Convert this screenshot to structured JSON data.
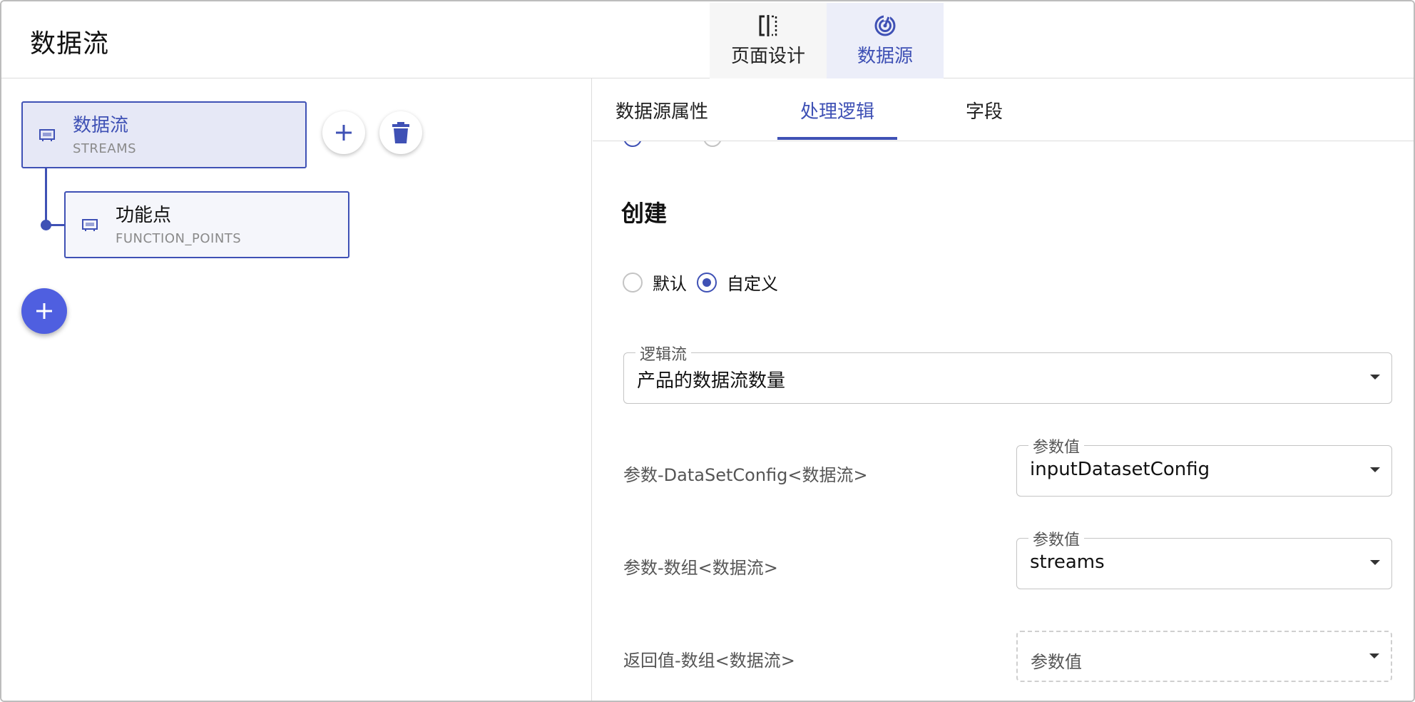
{
  "header": {
    "title": "数据流",
    "mode_tabs": [
      {
        "label": "页面设计",
        "icon": "page-design-icon"
      },
      {
        "label": "数据源",
        "icon": "data-source-icon",
        "active": true
      }
    ]
  },
  "tree": {
    "root": {
      "name": "数据流",
      "code": "STREAMS",
      "icon": "table-icon"
    },
    "child": {
      "name": "功能点",
      "code": "FUNCTION_POINTS",
      "icon": "table-icon"
    }
  },
  "right_panel": {
    "tabs": [
      {
        "label": "数据源属性"
      },
      {
        "label": "处理逻辑",
        "active": true
      },
      {
        "label": "字段"
      }
    ],
    "section_title": "创建",
    "radio_options": [
      {
        "label": "默认",
        "checked": false
      },
      {
        "label": "自定义",
        "checked": true
      }
    ],
    "logic_flow": {
      "legend": "逻辑流",
      "value": "产品的数据流数量"
    },
    "params": [
      {
        "label": "参数-DataSetConfig<数据流>",
        "legend": "参数值",
        "value": "inputDatasetConfig"
      },
      {
        "label": "参数-数组<数据流>",
        "legend": "参数值",
        "value": "streams"
      }
    ],
    "return_value": {
      "label": "返回值-数组<数据流>",
      "placeholder": "参数值"
    }
  },
  "colors": {
    "accent": "#3f51b5",
    "fab": "#4f5fe0",
    "selected_bg": "#e6e8f6"
  }
}
